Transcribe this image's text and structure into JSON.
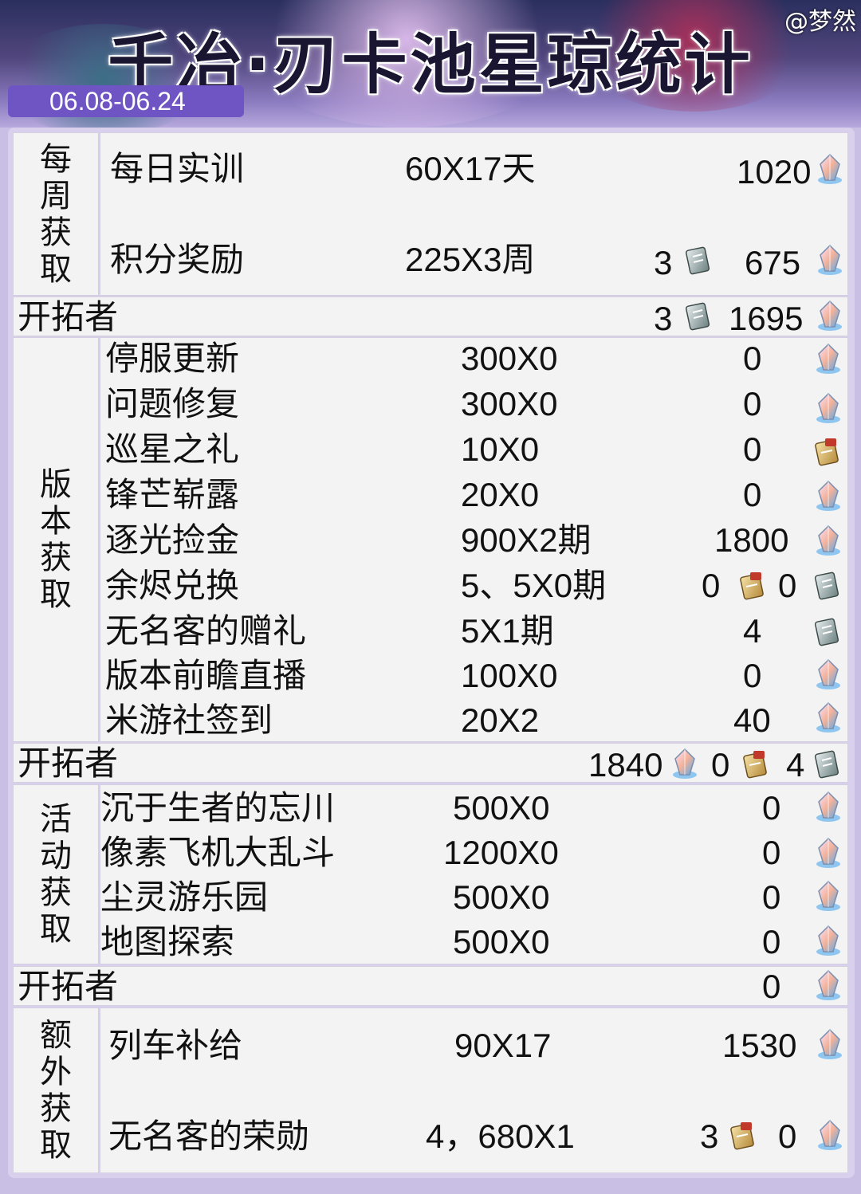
{
  "header": {
    "title": "千冶·刃卡池星琼统计",
    "credit": "@梦然",
    "date_range": "06.08-06.24"
  },
  "sections": {
    "weekly": {
      "label": "每周获取",
      "rows": [
        {
          "name": "每日实训",
          "formula": "60X17天",
          "value": "1020"
        },
        {
          "name": "积分奖励",
          "formula": "225X3周",
          "pass": "3",
          "value": "675"
        }
      ],
      "subtotal": {
        "label": "开拓者",
        "pass": "3",
        "value": "1695"
      }
    },
    "version": {
      "label": "版本获取",
      "rows": [
        {
          "name": "停服更新",
          "formula": "300X0",
          "value": "0"
        },
        {
          "name": "问题修复",
          "formula": "300X0",
          "value": "0"
        },
        {
          "name": "巡星之礼",
          "formula": "10X0",
          "value": "0"
        },
        {
          "name": "锋芒崭露",
          "formula": "20X0",
          "value": "0"
        },
        {
          "name": "逐光捡金",
          "formula": "900X2期",
          "value": "1800"
        },
        {
          "name": "余烬兑换",
          "formula": "5、5X0期",
          "v1": "0",
          "v2": "0"
        },
        {
          "name": "无名客的赠礼",
          "formula": "5X1期",
          "value": "4"
        },
        {
          "name": "版本前瞻直播",
          "formula": "100X0",
          "value": "0"
        },
        {
          "name": "米游社签到",
          "formula": "20X2",
          "value": "40"
        }
      ],
      "subtotal": {
        "label": "开拓者",
        "jade": "1840",
        "special": "0",
        "pass": "4"
      }
    },
    "event": {
      "label": "活动获取",
      "rows": [
        {
          "name": "沉于生者的忘川",
          "formula": "500X0",
          "value": "0"
        },
        {
          "name": "像素飞机大乱斗",
          "formula": "1200X0",
          "value": "0"
        },
        {
          "name": "尘灵游乐园",
          "formula": "500X0",
          "value": "0"
        },
        {
          "name": "地图探索",
          "formula": "500X0",
          "value": "0"
        }
      ],
      "subtotal": {
        "label": "开拓者",
        "value": "0"
      }
    },
    "extra": {
      "label": "额外获取",
      "rows": [
        {
          "name": "列车补给",
          "formula": "90X17",
          "value": "1530"
        },
        {
          "name": "无名客的荣勋",
          "formula": "4，680X1",
          "special": "3",
          "value": "0"
        }
      ]
    }
  },
  "icons": {
    "jade": "stellar-jade-icon",
    "pass": "star-rail-pass-icon",
    "special": "special-pass-icon"
  },
  "colors": {
    "accent": "#6f55c4",
    "panel": "#d8d0ec",
    "cell": "#f3f3f3"
  }
}
